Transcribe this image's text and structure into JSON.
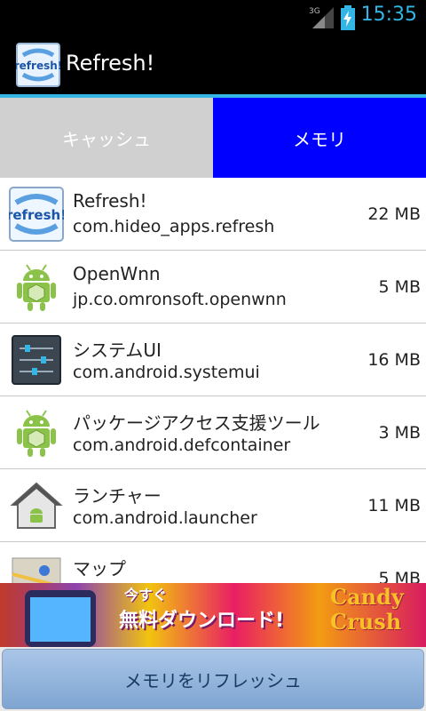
{
  "status_bar": {
    "network_type": "3G",
    "time": "15:35",
    "accent_color": "#33b5e5"
  },
  "action_bar": {
    "app_icon_text": "refresh!",
    "title": "Refresh!"
  },
  "tabs": [
    {
      "label": "キャッシュ",
      "selected": false
    },
    {
      "label": "メモリ",
      "selected": true
    }
  ],
  "apps": [
    {
      "name": "Refresh!",
      "package": "com.hideo_apps.refresh",
      "size": "22 MB",
      "icon": "refresh-app-icon"
    },
    {
      "name": "OpenWnn",
      "package": "jp.co.omronsoft.openwnn",
      "size": "5 MB",
      "icon": "android-robot-icon"
    },
    {
      "name": "システムUI",
      "package": "com.android.systemui",
      "size": "16 MB",
      "icon": "settings-sliders-icon"
    },
    {
      "name": "パッケージアクセス支援ツール",
      "package": "com.android.defcontainer",
      "size": "3 MB",
      "icon": "android-robot-icon"
    },
    {
      "name": "ランチャー",
      "package": "com.android.launcher",
      "size": "11 MB",
      "icon": "launcher-home-icon"
    },
    {
      "name": "マップ",
      "package": "",
      "size": "5 MB",
      "icon": "maps-icon"
    }
  ],
  "ad": {
    "sub": "今すぐ",
    "headline": "無料ダウンロード!",
    "brand_line1": "Candy",
    "brand_line2": "Crush"
  },
  "bottom_button": {
    "label": "メモリをリフレッシュ"
  }
}
